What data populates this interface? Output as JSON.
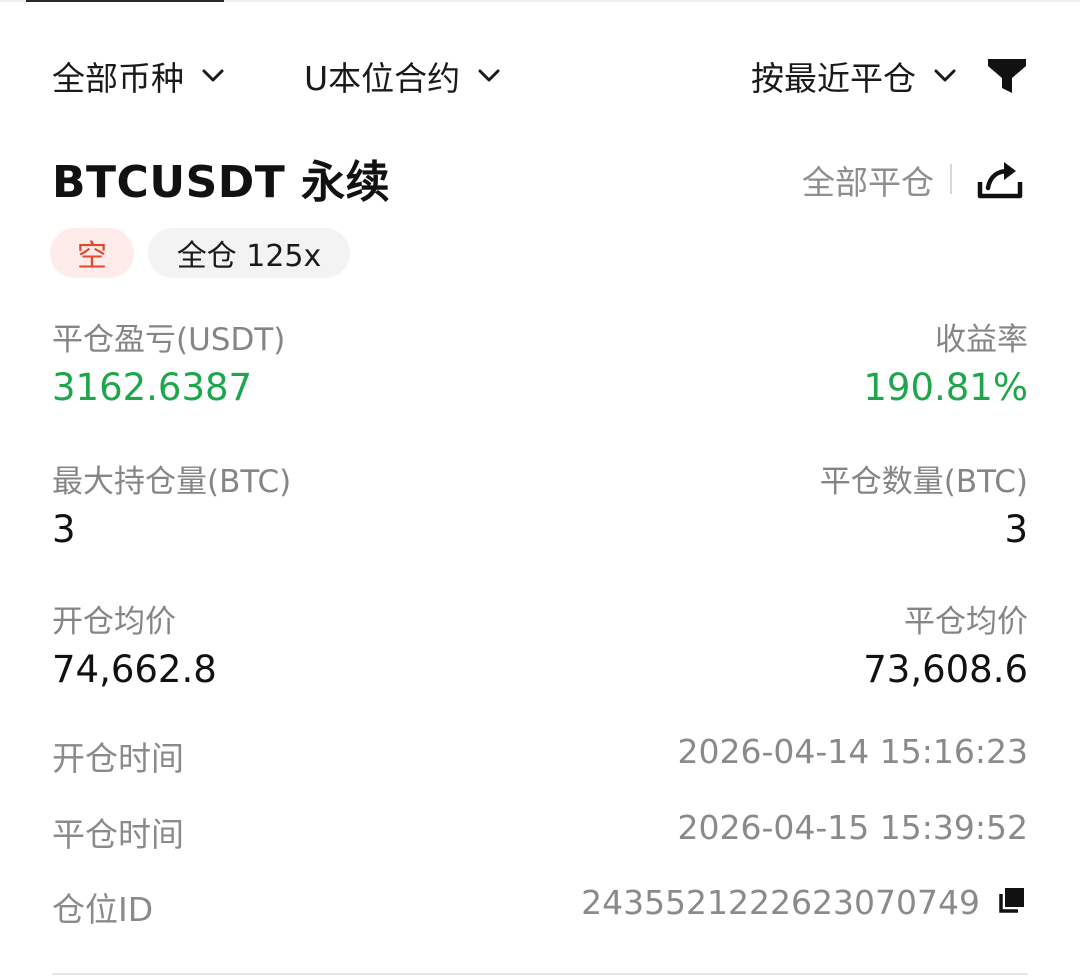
{
  "filters": {
    "coin": "全部币种",
    "contract": "U本位合约",
    "sort": "按最近平仓",
    "filter_icon": "funnel-icon",
    "chevron_icon": "chevron-down-icon"
  },
  "position": {
    "symbol": "BTCUSDT 永续",
    "close_all_label": "全部平仓",
    "share_icon": "share-icon",
    "side_badge": "空",
    "margin_badge": "全仓 125x",
    "side_color": "#e0492f",
    "profit_color": "#1fa64a"
  },
  "stats": {
    "pnl_label": "平仓盈亏(USDT)",
    "pnl_value": "3162.6387",
    "roi_label": "收益率",
    "roi_value": "190.81%",
    "max_position_label": "最大持仓量(BTC)",
    "max_position_value": "3",
    "closed_qty_label": "平仓数量(BTC)",
    "closed_qty_value": "3",
    "open_avg_label": "开仓均价",
    "open_avg_value": "74,662.8",
    "close_avg_label": "平仓均价",
    "close_avg_value": "73,608.6"
  },
  "details": {
    "open_time_label": "开仓时间",
    "open_time_value": "2026-04-14 15:16:23",
    "close_time_label": "平仓时间",
    "close_time_value": "2026-04-15 15:39:52",
    "position_id_label": "仓位ID",
    "position_id_value": "2435521222623070749",
    "copy_icon": "copy-icon"
  }
}
